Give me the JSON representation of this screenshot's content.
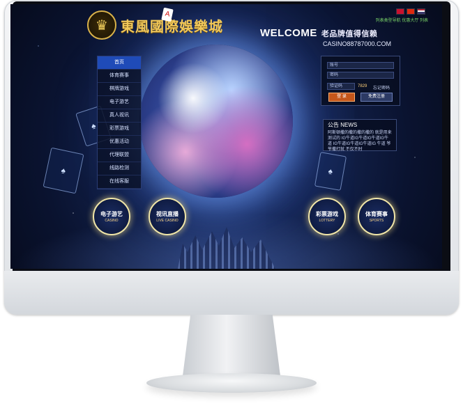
{
  "logo": {
    "text": "東風國際娛樂城",
    "emblem": "♛",
    "card": "A"
  },
  "top_links": {
    "text": "列表类型导航  优惠大厅  列表"
  },
  "welcome": {
    "title": "WELCOME",
    "subtitle": "老品牌值得信赖"
  },
  "domain_text": "CASINO88787000.COM",
  "nav": {
    "items": [
      "首页",
      "体育赛事",
      "棋牌游戏",
      "电子游艺",
      "真人视讯",
      "彩票游戏",
      "优惠活动",
      "代理联盟",
      "线路检测",
      "在线客服"
    ]
  },
  "login": {
    "account_placeholder": "账号",
    "password_placeholder": "密码",
    "captcha_placeholder": "验证码",
    "captcha_code": "7829",
    "forgot_label": "忘记密码",
    "login_label": "登 录",
    "register_label": "免费注册"
  },
  "notice": {
    "title": "公告 NEWS",
    "body": "阿斯顿撒的撒的撒的撒的 就是用来测试的 IG牛道IG牛道IG牛道IG牛道 IG牛道IG牛道IG牛道IG 牛道 爷爷撒打就 不仅不时"
  },
  "circles": [
    {
      "cn": "电子游艺",
      "en": "CASINO"
    },
    {
      "cn": "视讯直播",
      "en": "LIVE CASINO"
    },
    {
      "cn": "彩票游戏",
      "en": "LOTTERY"
    },
    {
      "cn": "体育赛事",
      "en": "SPORTS"
    }
  ],
  "cards": [
    "♠",
    "♠",
    "♠"
  ],
  "flag_colors": [
    "#c8102e",
    "#de2910",
    "#3c3b6e"
  ]
}
